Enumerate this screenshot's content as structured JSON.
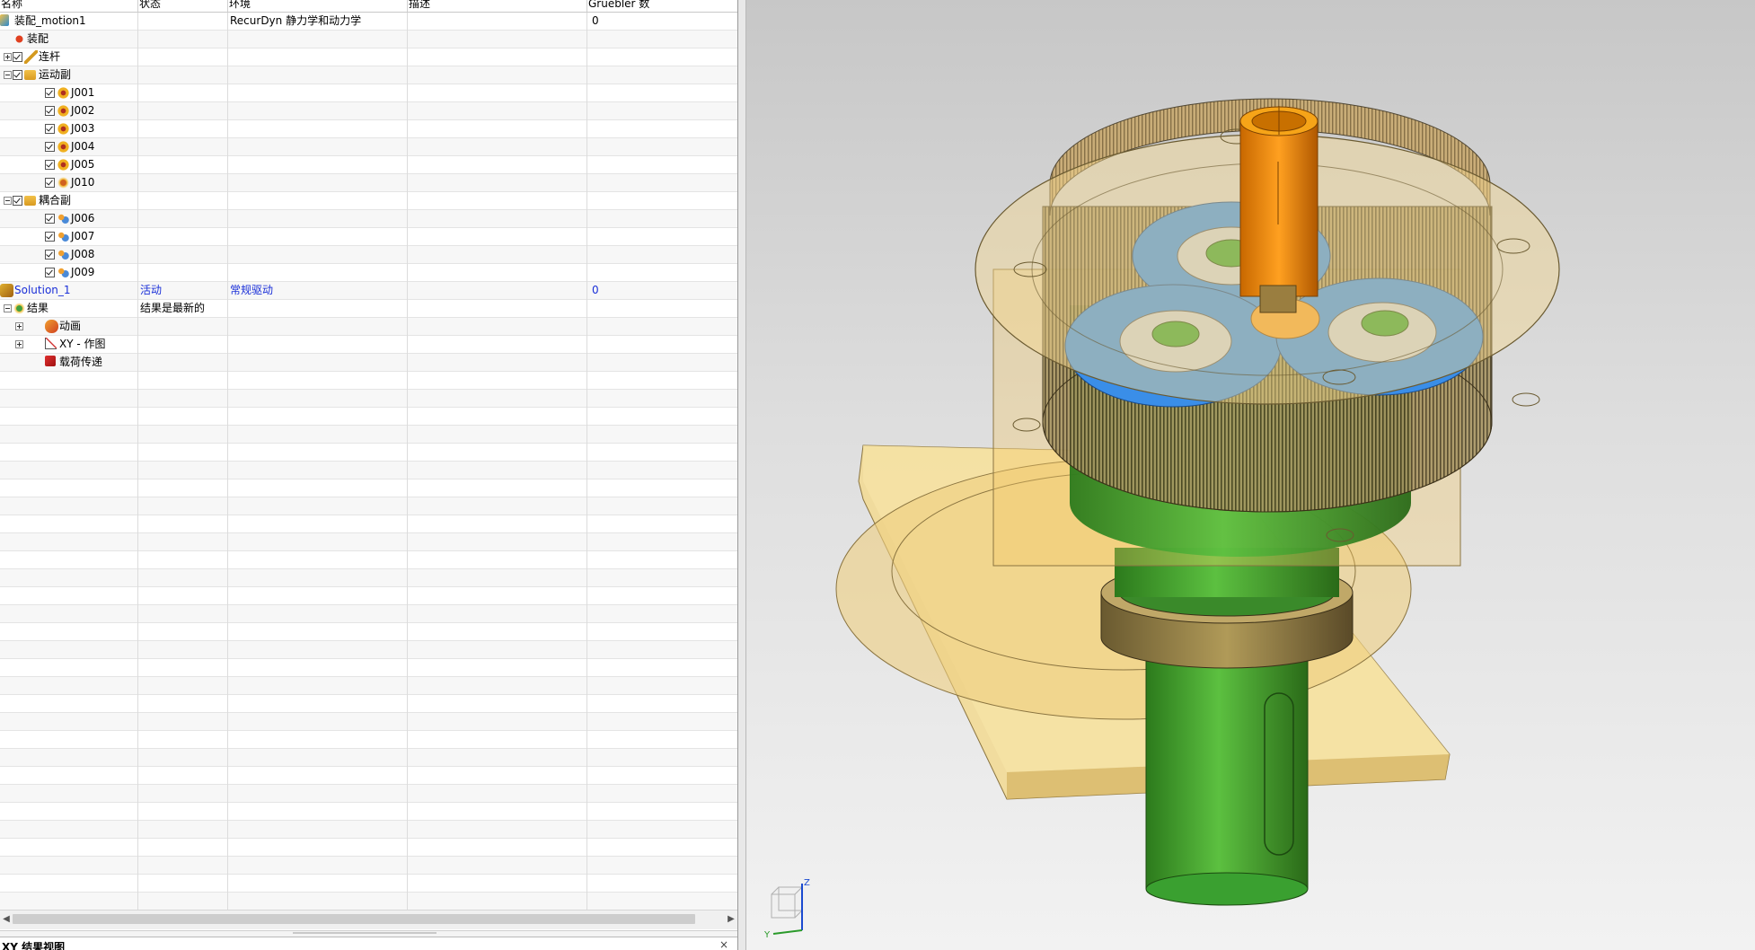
{
  "columns": [
    "名称",
    "状态",
    "环境",
    "描述",
    "Gruebler 数"
  ],
  "rows": [
    {
      "name": "装配_motion1",
      "status": "",
      "env": "RecurDyn 静力学和动力学",
      "desc": "",
      "gruebler": "0",
      "icon": "motion-file-icon",
      "exp": "",
      "cb": false,
      "level": 0
    },
    {
      "name": "装配",
      "status": "",
      "env": "",
      "desc": "",
      "gruebler": "",
      "icon": "assembly-icon",
      "exp": "",
      "cb": false,
      "level": 1
    },
    {
      "name": "连杆",
      "status": "",
      "env": "",
      "desc": "",
      "gruebler": "",
      "icon": "link-icon",
      "exp": "plus",
      "cb": true,
      "level": 1
    },
    {
      "name": "运动副",
      "status": "",
      "env": "",
      "desc": "",
      "gruebler": "",
      "icon": "joints-folder-icon",
      "exp": "minus",
      "cb": true,
      "level": 1
    },
    {
      "name": "J001",
      "status": "",
      "env": "",
      "desc": "",
      "gruebler": "",
      "icon": "revolute-joint-icon",
      "exp": "",
      "cb": true,
      "level": 2
    },
    {
      "name": "J002",
      "status": "",
      "env": "",
      "desc": "",
      "gruebler": "",
      "icon": "revolute-joint-icon",
      "exp": "",
      "cb": true,
      "level": 2
    },
    {
      "name": "J003",
      "status": "",
      "env": "",
      "desc": "",
      "gruebler": "",
      "icon": "revolute-joint-icon",
      "exp": "",
      "cb": true,
      "level": 2
    },
    {
      "name": "J004",
      "status": "",
      "env": "",
      "desc": "",
      "gruebler": "",
      "icon": "revolute-joint-icon",
      "exp": "",
      "cb": true,
      "level": 2
    },
    {
      "name": "J005",
      "status": "",
      "env": "",
      "desc": "",
      "gruebler": "",
      "icon": "revolute-joint-icon",
      "exp": "",
      "cb": true,
      "level": 2
    },
    {
      "name": "J010",
      "status": "",
      "env": "",
      "desc": "",
      "gruebler": "",
      "icon": "driver-joint-icon",
      "exp": "",
      "cb": true,
      "level": 2
    },
    {
      "name": "耦合副",
      "status": "",
      "env": "",
      "desc": "",
      "gruebler": "",
      "icon": "couplers-folder-icon",
      "exp": "minus",
      "cb": true,
      "level": 1
    },
    {
      "name": "J006",
      "status": "",
      "env": "",
      "desc": "",
      "gruebler": "",
      "icon": "gear-coupler-icon",
      "exp": "",
      "cb": true,
      "level": 2
    },
    {
      "name": "J007",
      "status": "",
      "env": "",
      "desc": "",
      "gruebler": "",
      "icon": "gear-coupler-icon",
      "exp": "",
      "cb": true,
      "level": 2
    },
    {
      "name": "J008",
      "status": "",
      "env": "",
      "desc": "",
      "gruebler": "",
      "icon": "gear-coupler-icon",
      "exp": "",
      "cb": true,
      "level": 2
    },
    {
      "name": "J009",
      "status": "",
      "env": "",
      "desc": "",
      "gruebler": "",
      "icon": "gear-coupler-icon",
      "exp": "",
      "cb": true,
      "level": 2
    },
    {
      "name": "Solution_1",
      "status": "活动",
      "env": "常规驱动",
      "desc": "",
      "gruebler": "0",
      "icon": "solution-icon",
      "exp": "minus",
      "cb": false,
      "level": 0,
      "active": true
    },
    {
      "name": "结果",
      "status": "结果是最新的",
      "env": "",
      "desc": "",
      "gruebler": "",
      "icon": "results-icon",
      "exp": "minus",
      "cb": false,
      "level": 1
    },
    {
      "name": "动画",
      "status": "",
      "env": "",
      "desc": "",
      "gruebler": "",
      "icon": "animation-icon",
      "exp": "plus",
      "cb": false,
      "level": 2
    },
    {
      "name": "XY - 作图",
      "status": "",
      "env": "",
      "desc": "",
      "gruebler": "",
      "icon": "xy-graph-icon",
      "exp": "plus",
      "cb": false,
      "level": 2
    },
    {
      "name": "载荷传递",
      "status": "",
      "env": "",
      "desc": "",
      "gruebler": "",
      "icon": "load-transfer-icon",
      "exp": "",
      "cb": false,
      "level": 2
    }
  ],
  "bottom_panel": {
    "title": "XY 结果视图",
    "close": "×"
  },
  "triad": {
    "z": "Z",
    "y": "Y"
  },
  "colors": {
    "active_text": "#1a2fd8",
    "housing": "#f0c060",
    "gear_blue": "#3a8ee8",
    "shaft_green": "#3aa030",
    "shaft_orange": "#f09010"
  }
}
